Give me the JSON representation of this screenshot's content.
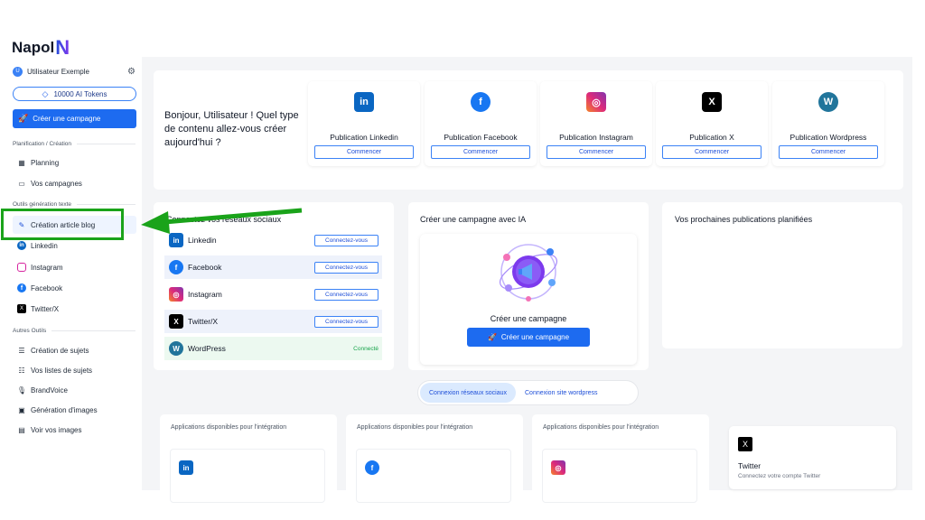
{
  "logo": {
    "text": "Napol",
    "mark": "N"
  },
  "user": {
    "initial": "U",
    "name": "Utilisateur Exemple"
  },
  "tokens": "10000 AI Tokens",
  "create_campaign": "Créer une campagne",
  "sections": {
    "planning": "Planification / Création",
    "text_tools": "Outils génération texte",
    "other_tools": "Autres Outils"
  },
  "nav": {
    "planning": "Planning",
    "campaigns": "Vos campagnes",
    "blog": "Création article blog",
    "linkedin": "Linkedin",
    "instagram": "Instagram",
    "facebook": "Facebook",
    "twitter": "Twitter/X",
    "subjects": "Création de sujets",
    "subject_lists": "Vos listes de sujets",
    "brandvoice": "BrandVoice",
    "images_gen": "Génération d'images",
    "images": "Voir vos images"
  },
  "greeting": "Bonjour, Utilisateur ! Quel type de contenu allez-vous créer aujourd'hui ?",
  "publications": [
    {
      "label": "Publication Linkedin",
      "button": "Commencer",
      "color": "#0a66c2",
      "glyph": "in"
    },
    {
      "label": "Publication Facebook",
      "button": "Commencer",
      "color": "#1877f2",
      "glyph": "f"
    },
    {
      "label": "Publication Instagram",
      "button": "Commencer",
      "color": "#d6249f",
      "glyph": "◎"
    },
    {
      "label": "Publication X",
      "button": "Commencer",
      "color": "#000000",
      "glyph": "X"
    },
    {
      "label": "Publication Wordpress",
      "button": "Commencer",
      "color": "#21759b",
      "glyph": "W"
    }
  ],
  "networks": {
    "title": "Connectez vos réseaux sociaux",
    "rows": [
      {
        "name": "Linkedin",
        "action": "Connectez-vous",
        "color": "#0a66c2",
        "glyph": "in"
      },
      {
        "name": "Facebook",
        "action": "Connectez-vous",
        "color": "#1877f2",
        "glyph": "f"
      },
      {
        "name": "Instagram",
        "action": "Connectez-vous",
        "color": "#d6249f",
        "glyph": "◎"
      },
      {
        "name": "Twitter/X",
        "action": "Connectez-vous",
        "color": "#000000",
        "glyph": "X"
      },
      {
        "name": "WordPress",
        "action": "Connecté",
        "color": "#21759b",
        "glyph": "W"
      }
    ]
  },
  "ai": {
    "title": "Créer une campagne avec IA",
    "card_title": "Créer une campagne",
    "button": "Créer une campagne"
  },
  "upcoming": "Vos prochaines publications planifiées",
  "tabs": [
    "Connexion réseaux sociaux",
    "Connexion site wordpress"
  ],
  "apps": {
    "heading": "Applications disponibles pour l'intégration",
    "twitter_title": "Twitter",
    "twitter_sub": "Connectez votre compte Twitter"
  }
}
